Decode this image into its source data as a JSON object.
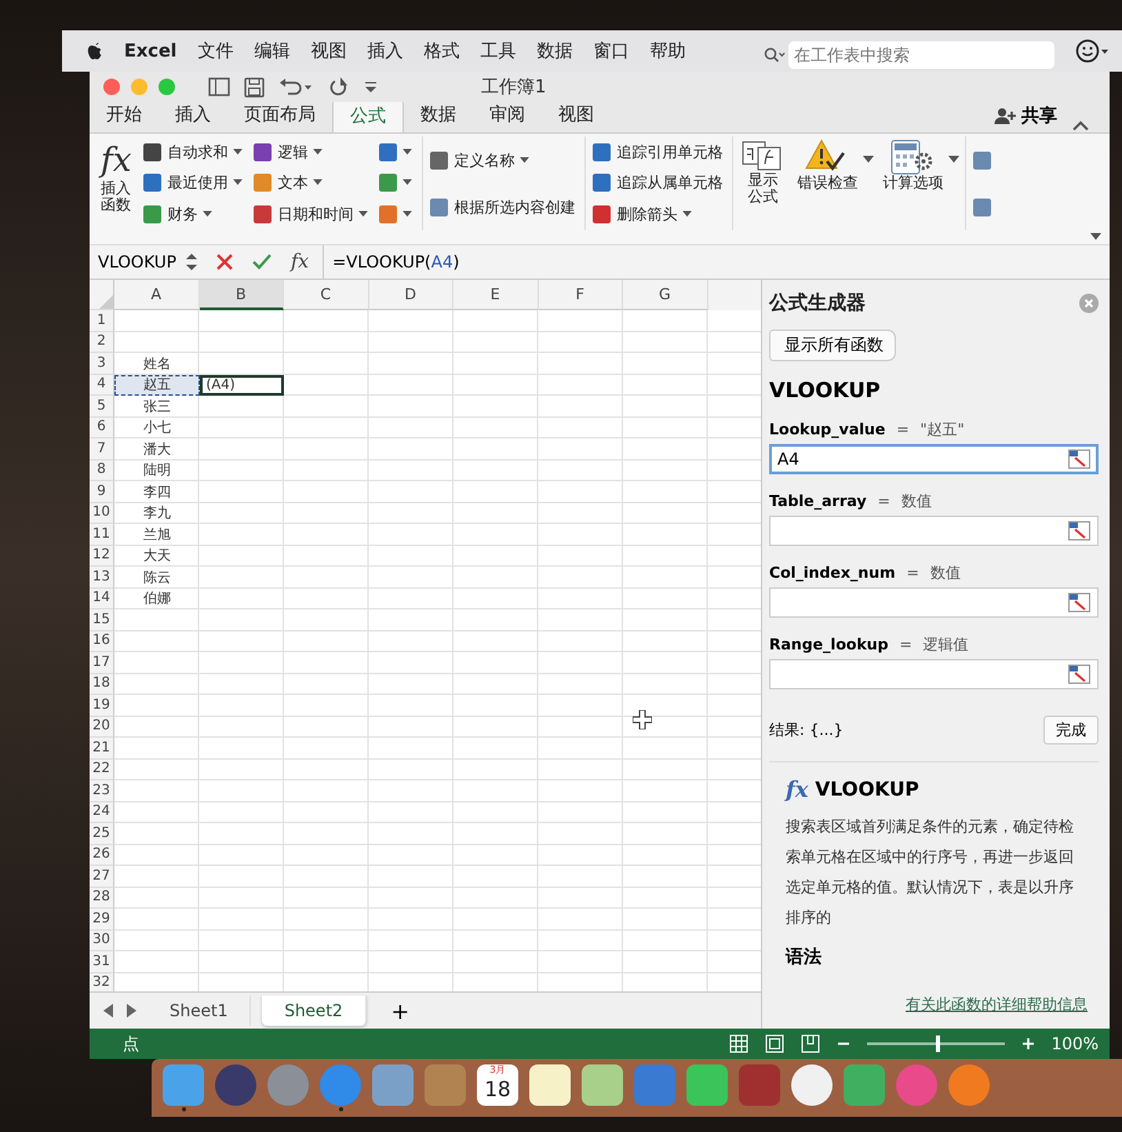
{
  "menubar": {
    "items": [
      "Excel",
      "文件",
      "编辑",
      "视图",
      "插入",
      "格式",
      "工具",
      "数据",
      "窗口",
      "帮助"
    ]
  },
  "search": {
    "placeholder": "在工作表中搜索"
  },
  "window": {
    "title": "工作簿1",
    "share": "共享"
  },
  "tabs": [
    {
      "label": "开始",
      "selected": false
    },
    {
      "label": "插入",
      "selected": false
    },
    {
      "label": "页面布局",
      "selected": false
    },
    {
      "label": "公式",
      "selected": true
    },
    {
      "label": "数据",
      "selected": false
    },
    {
      "label": "审阅",
      "selected": false
    },
    {
      "label": "视图",
      "selected": false
    }
  ],
  "ribbon": [
    {
      "kind": "large",
      "icon_text": "fx",
      "lines": [
        "插入",
        "函数"
      ],
      "has_menu": false
    },
    {
      "kind": "column",
      "items": [
        {
          "label": "自动求和",
          "has_menu": true
        },
        {
          "label": "最近使用",
          "has_menu": true
        },
        {
          "label": "财务",
          "has_menu": true
        }
      ]
    },
    {
      "kind": "column",
      "items": [
        {
          "label": "逻辑",
          "has_menu": true
        },
        {
          "label": "文本",
          "has_menu": true
        },
        {
          "label": "日期和时间",
          "has_menu": true
        }
      ]
    },
    {
      "kind": "column",
      "items": [
        {
          "has_menu": true
        },
        {
          "has_menu": true
        },
        {
          "has_menu": true
        }
      ]
    },
    {
      "kind": "column",
      "items": [
        {
          "label": "定义名称",
          "has_menu": true
        },
        {
          "label": "根据所选内容创建",
          "has_menu": false
        }
      ]
    },
    {
      "kind": "column",
      "items": [
        {
          "label": "追踪引用单元格",
          "has_menu": false
        },
        {
          "label": "追踪从属单元格",
          "has_menu": false
        },
        {
          "label": "删除箭头",
          "has_menu": true
        }
      ]
    },
    {
      "kind": "large",
      "lines": [
        "显示",
        "公式"
      ],
      "has_menu": false
    },
    {
      "kind": "large",
      "lines": [
        "错误检查"
      ],
      "has_menu": true
    },
    {
      "kind": "large",
      "lines": [
        "计算选项"
      ],
      "has_menu": true
    },
    {
      "kind": "column",
      "items": [
        {
          "has_menu": false
        },
        {
          "has_menu": false
        }
      ]
    }
  ],
  "formula_bar": {
    "name_box": "VLOOKUP",
    "fx": "fx",
    "formula_start": "=VLOOKUP(",
    "formula_ref": "A4",
    "formula_end": ")"
  },
  "sheet": {
    "columns": [
      "A",
      "B",
      "C",
      "D",
      "E",
      "F",
      "G"
    ],
    "rows": [
      {
        "number": "1",
        "cells": []
      },
      {
        "number": "2",
        "cells": []
      },
      {
        "number": "3",
        "cells": [
          {
            "text": "姓名",
            "referenced": false,
            "selected": false
          }
        ]
      },
      {
        "number": "4",
        "cells": [
          {
            "text": "赵五",
            "referenced": true,
            "selected": false
          },
          {
            "text": "(A4)",
            "referenced": false,
            "selected": true
          }
        ]
      },
      {
        "number": "5",
        "cells": [
          {
            "text": "张三",
            "referenced": false,
            "selected": false
          }
        ]
      },
      {
        "number": "6",
        "cells": [
          {
            "text": "小七",
            "referenced": false,
            "selected": false
          }
        ]
      },
      {
        "number": "7",
        "cells": [
          {
            "text": "潘大",
            "referenced": false,
            "selected": false
          }
        ]
      },
      {
        "number": "8",
        "cells": [
          {
            "text": "陆明",
            "referenced": false,
            "selected": false
          }
        ]
      },
      {
        "number": "9",
        "cells": [
          {
            "text": "李四",
            "referenced": false,
            "selected": false
          }
        ]
      },
      {
        "number": "10",
        "cells": [
          {
            "text": "李九",
            "referenced": false,
            "selected": false
          }
        ]
      },
      {
        "number": "11",
        "cells": [
          {
            "text": "兰旭",
            "referenced": false,
            "selected": false
          }
        ]
      },
      {
        "number": "12",
        "cells": [
          {
            "text": "大天",
            "referenced": false,
            "selected": false
          }
        ]
      },
      {
        "number": "13",
        "cells": [
          {
            "text": "陈云",
            "referenced": false,
            "selected": false
          }
        ]
      },
      {
        "number": "14",
        "cells": [
          {
            "text": "伯娜",
            "referenced": false,
            "selected": false
          }
        ]
      },
      {
        "number": "15",
        "cells": []
      },
      {
        "number": "16",
        "cells": []
      },
      {
        "number": "17",
        "cells": []
      },
      {
        "number": "18",
        "cells": []
      },
      {
        "number": "19",
        "cells": []
      },
      {
        "number": "20",
        "cells": []
      },
      {
        "number": "21",
        "cells": []
      },
      {
        "number": "22",
        "cells": []
      },
      {
        "number": "23",
        "cells": []
      },
      {
        "number": "24",
        "cells": []
      },
      {
        "number": "25",
        "cells": []
      },
      {
        "number": "26",
        "cells": []
      },
      {
        "number": "27",
        "cells": []
      },
      {
        "number": "28",
        "cells": []
      },
      {
        "number": "29",
        "cells": []
      },
      {
        "number": "30",
        "cells": []
      },
      {
        "number": "31",
        "cells": []
      },
      {
        "number": "32",
        "cells": []
      }
    ]
  },
  "sheet_tabs": [
    {
      "label": "Sheet1",
      "selected": false
    },
    {
      "label": "Sheet2",
      "selected": true
    }
  ],
  "add_sheet": "+",
  "status_bar": {
    "mode": "点",
    "zoom": "100%",
    "zoom_slider": {
      "level": 0.5
    }
  },
  "panel": {
    "title": "公式生成器",
    "back": "显示所有函数",
    "function": "VLOOKUP",
    "arguments": [
      {
        "name": "Lookup_value",
        "equals": "=",
        "result": "\"赵五\"",
        "value": "A4",
        "focused": true
      },
      {
        "name": "Table_array",
        "equals": "=",
        "result": "数值",
        "focused": false
      },
      {
        "name": "Col_index_num",
        "equals": "=",
        "result": "数值",
        "focused": false
      },
      {
        "name": "Range_lookup",
        "equals": "=",
        "result": "逻辑值",
        "focused": false
      }
    ],
    "result": "结果: {...}",
    "done": "完成",
    "help_icon": "fx",
    "help_title": "VLOOKUP",
    "description": "搜索表区域首列满足条件的元素，确定待检索单元格在区域中的行序号，再进一步返回选定单元格的值。默认情况下，表是以升序排序的",
    "syntax": "语法",
    "help_link": "有关此函数的详细帮助信息"
  },
  "dock": [
    {
      "kind": "finder",
      "running": true
    },
    {
      "kind": "siri",
      "running": false
    },
    {
      "kind": "launchpad",
      "running": false
    },
    {
      "kind": "safari",
      "running": true
    },
    {
      "kind": "preview",
      "running": false
    },
    {
      "kind": "contacts",
      "running": false
    },
    {
      "kind": "calendar",
      "running": false,
      "month": "3月",
      "day": "18"
    },
    {
      "kind": "notes",
      "running": false
    },
    {
      "kind": "maps",
      "running": false
    },
    {
      "kind": "keynote",
      "running": false
    },
    {
      "kind": "facetime",
      "running": false
    },
    {
      "kind": "photobooth",
      "running": false
    },
    {
      "kind": "photos",
      "running": false
    },
    {
      "kind": "numbers",
      "running": false
    },
    {
      "kind": "music",
      "running": false
    },
    {
      "kind": "books",
      "running": false
    }
  ]
}
